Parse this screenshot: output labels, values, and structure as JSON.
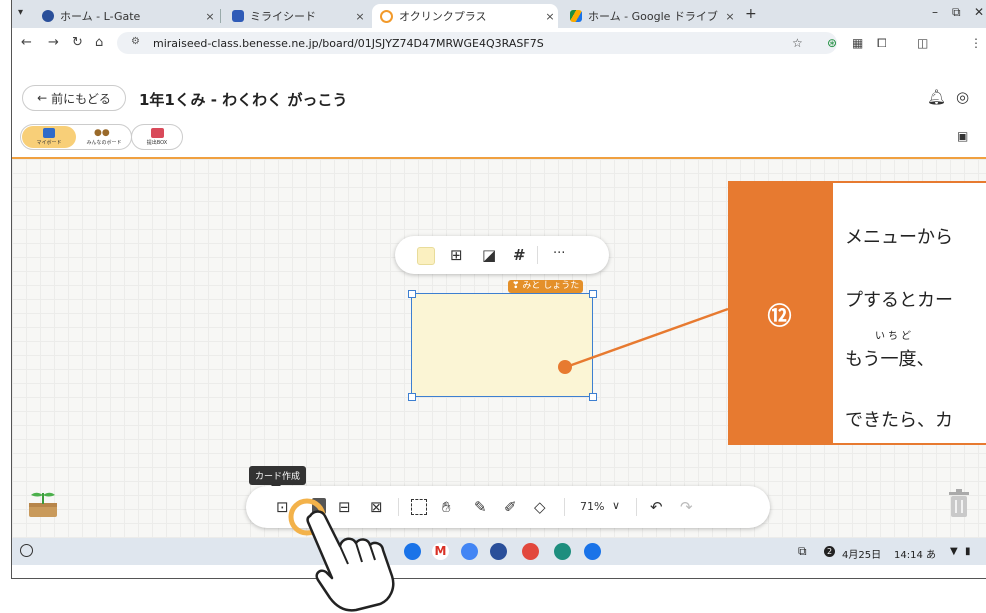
{
  "browser": {
    "tabs": [
      {
        "label": "ホーム - L-Gate",
        "close": "×"
      },
      {
        "label": "ミライシード",
        "close": "×"
      },
      {
        "label": "オクリンクプラス",
        "close": "×"
      },
      {
        "label": "ホーム - Google ドライブ",
        "close": "×"
      }
    ],
    "new_tab": "+",
    "url": "miraiseed-class.benesse.ne.jp/board/01JSJYZ74D47MRWGE4Q3RASF7S"
  },
  "app": {
    "back_label": "前にもどる",
    "title": "1年1くみ - わくわく がっこう",
    "pill_myboard": "マイボード",
    "pill_everyone": "みんなのボード",
    "pill_box": "提出BOX"
  },
  "canvas": {
    "card_author": "みと しょうた",
    "card_toolbar_more": "···",
    "card_toolbar_hash": "#"
  },
  "annotation": {
    "number": "⑫",
    "line1": "メニューから",
    "line2": "プするとカー",
    "line3": "もう一度、",
    "line3_ruby": "いちど",
    "line4": "できたら、カ"
  },
  "toolbar": {
    "tooltip": "カード作成",
    "zoom": "71%",
    "zoom_caret": "∨"
  },
  "shelf": {
    "badge": "2",
    "date": "4月25日",
    "time": "14:14 あ"
  },
  "colors": {
    "accent_orange": "#e77a30",
    "card_fill": "#fbf5d5",
    "selection_blue": "#3d7fd1"
  }
}
